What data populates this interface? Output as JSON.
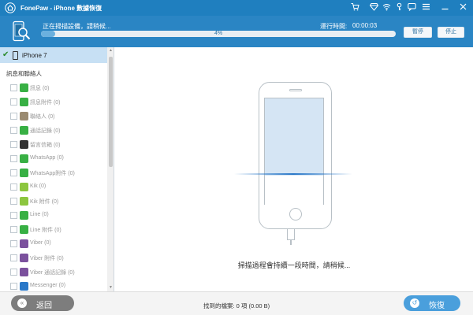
{
  "window": {
    "title": "FonePaw - iPhone 數據恢復",
    "controls": [
      "cart-icon",
      "diamond-icon",
      "wifi-icon",
      "key-icon",
      "chat-icon",
      "menu-icon",
      "minimize-icon",
      "close-icon"
    ]
  },
  "progress": {
    "status": "正在掃描設備，請稍候...",
    "runtime_label": "運行時間:",
    "runtime_value": "00:00:03",
    "percent": 4,
    "percent_text": "4%",
    "pause_label": "暫停",
    "stop_label": "停止"
  },
  "sidebar": {
    "device": "iPhone 7",
    "device_checked": true,
    "section": "訊息和聯絡人",
    "items": [
      {
        "label": "訊息 (0)",
        "icon": "message-icon",
        "color": "#38b044"
      },
      {
        "label": "訊息附件 (0)",
        "icon": "message-attachment-icon",
        "color": "#38b044"
      },
      {
        "label": "聯絡人 (0)",
        "icon": "contacts-icon",
        "color": "#9a8a70"
      },
      {
        "label": "通話記錄 (0)",
        "icon": "phone-icon",
        "color": "#38b044"
      },
      {
        "label": "留言信箱 (0)",
        "icon": "voicemail-icon",
        "color": "#333333"
      },
      {
        "label": "WhatsApp (0)",
        "icon": "whatsapp-icon",
        "color": "#38b044"
      },
      {
        "label": "WhatsApp附件 (0)",
        "icon": "whatsapp-attachment-icon",
        "color": "#38b044"
      },
      {
        "label": "Kik (0)",
        "icon": "kik-icon",
        "color": "#8cc63f"
      },
      {
        "label": "Kik 附件 (0)",
        "icon": "kik-attachment-icon",
        "color": "#8cc63f"
      },
      {
        "label": "Line (0)",
        "icon": "line-icon",
        "color": "#38b044"
      },
      {
        "label": "Line 附件 (0)",
        "icon": "line-attachment-icon",
        "color": "#38b044"
      },
      {
        "label": "Viber (0)",
        "icon": "viber-icon",
        "color": "#7b519d"
      },
      {
        "label": "Viber 附件 (0)",
        "icon": "viber-attachment-icon",
        "color": "#7b519d"
      },
      {
        "label": "Viber 通話記錄 (0)",
        "icon": "viber-calls-icon",
        "color": "#7b519d"
      },
      {
        "label": "Messenger (0)",
        "icon": "messenger-icon",
        "color": "#2a78c8"
      }
    ]
  },
  "main": {
    "message": "掃描過程會持續一段時間，請稍候..."
  },
  "footer": {
    "back_label": "返回",
    "found_text": "找到的檔案: 0 項 (0.00 B)",
    "recover_label": "恢復"
  }
}
